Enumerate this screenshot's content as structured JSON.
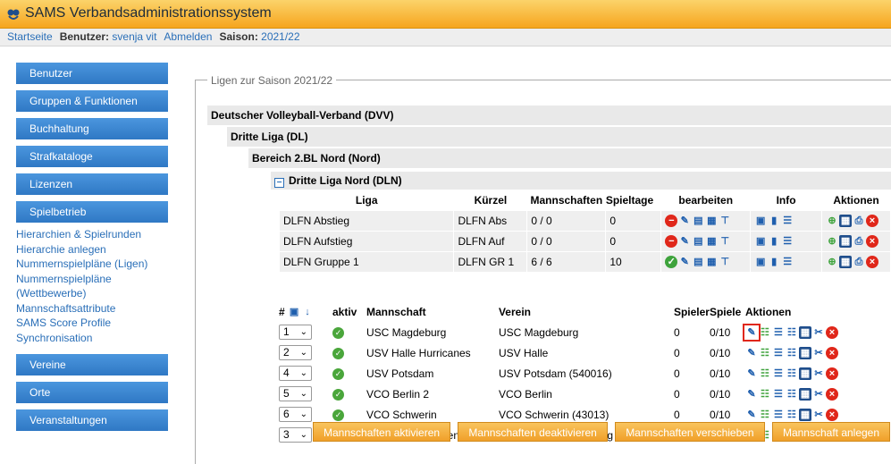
{
  "app": {
    "title": "SAMS Verbandsadministrationssystem"
  },
  "topnav": {
    "home": "Startseite",
    "user_label": "Benutzer:",
    "user": "svenja vit",
    "logout": "Abmelden",
    "season_label": "Saison:",
    "season": "2021/22"
  },
  "sidebar": {
    "buttons": [
      "Benutzer",
      "Gruppen & Funktionen",
      "Buchhaltung",
      "Strafkataloge",
      "Lizenzen",
      "Spielbetrieb"
    ],
    "links": [
      "Hierarchien & Spielrunden",
      "Hierarchie anlegen",
      "Nummernspielpläne (Ligen)",
      "Nummernspielpläne (Wettbewerbe)",
      "Mannschaftsattribute",
      "SAMS Score Profile",
      "Synchronisation"
    ],
    "buttons2": [
      "Vereine",
      "Orte",
      "Veranstaltungen"
    ]
  },
  "main": {
    "legend": "Ligen zur Saison 2021/22",
    "level1": "Deutscher Volleyball-Verband (DVV)",
    "level2": "Dritte Liga (DL)",
    "level3": "Bereich 2.BL Nord (Nord)",
    "level4": "Dritte Liga Nord (DLN)"
  },
  "liga_table": {
    "headers": [
      "Liga",
      "Kürzel",
      "Mannschaften",
      "Spieltage",
      "bearbeiten",
      "Info",
      "Aktionen"
    ],
    "rows": [
      {
        "liga": "DLFN Abstieg",
        "kuerzel": "DLFN Abs",
        "mannschaften": "0 / 0",
        "spieltage": "0",
        "status": "red"
      },
      {
        "liga": "DLFN Aufstieg",
        "kuerzel": "DLFN Auf",
        "mannschaften": "0 / 0",
        "spieltage": "0",
        "status": "red"
      },
      {
        "liga": "DLFN Gruppe 1",
        "kuerzel": "DLFN GR 1",
        "mannschaften": "6 / 6",
        "spieltage": "10",
        "status": "green"
      }
    ]
  },
  "team_table": {
    "headers": {
      "nr": "#",
      "aktiv": "aktiv",
      "mannschaft": "Mannschaft",
      "verein": "Verein",
      "spieler": "Spieler",
      "spiele": "Spiele",
      "aktionen": "Aktionen"
    },
    "rows": [
      {
        "nr": "1",
        "mannschaft": "USC Magdeburg",
        "verein": "USC Magdeburg",
        "spieler": "0",
        "spiele": "0/10"
      },
      {
        "nr": "2",
        "mannschaft": "USV Halle Hurricanes",
        "verein": "USV Halle",
        "spieler": "0",
        "spiele": "0/10"
      },
      {
        "nr": "4",
        "mannschaft": "USV Potsdam",
        "verein": "USV Potsdam (540016)",
        "spieler": "0",
        "spiele": "0/10"
      },
      {
        "nr": "5",
        "mannschaft": "VCO Berlin 2",
        "verein": "VCO Berlin",
        "spieler": "0",
        "spiele": "0/10"
      },
      {
        "nr": "6",
        "mannschaft": "VCO Schwerin",
        "verein": "VCO Schwerin (43013)",
        "spieler": "0",
        "spiele": "0/10"
      },
      {
        "nr": "3",
        "mannschaft": "VSV Havel Oranienburg",
        "verein": "VSV Havel Oranienburg (650166)",
        "spieler": "0",
        "spiele": "0/10"
      }
    ]
  },
  "actions": {
    "activate": "Mannschaften aktivieren",
    "deactivate": "Mannschaften deaktivieren",
    "move": "Mannschaften verschieben",
    "create": "Mannschaft anlegen"
  },
  "colors": {
    "accent": "#f6a51e",
    "nav_button": "#3d8ad6",
    "link": "#2a6fb8"
  }
}
